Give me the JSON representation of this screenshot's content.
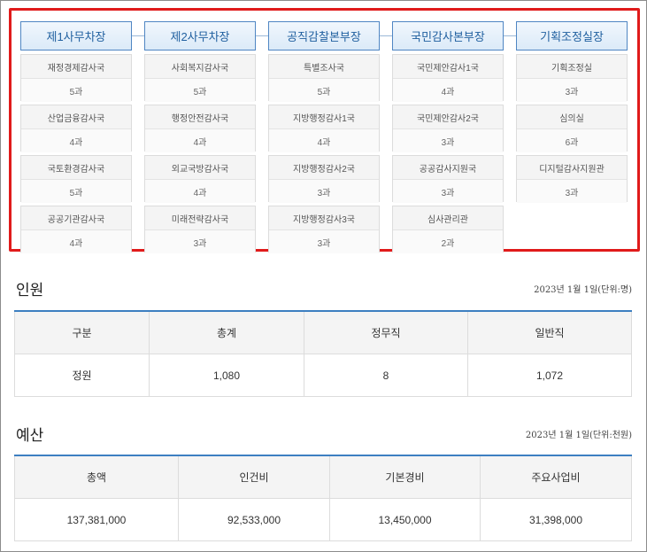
{
  "org": {
    "columns": [
      {
        "head": "제1사무차장",
        "units": [
          {
            "name": "재정경제감사국",
            "count": "5과"
          },
          {
            "name": "산업금융감사국",
            "count": "4과"
          },
          {
            "name": "국토환경감사국",
            "count": "5과"
          },
          {
            "name": "공공기관감사국",
            "count": "4과"
          }
        ]
      },
      {
        "head": "제2사무차장",
        "units": [
          {
            "name": "사회복지감사국",
            "count": "5과"
          },
          {
            "name": "행정안전감사국",
            "count": "4과"
          },
          {
            "name": "외교국방감사국",
            "count": "4과"
          },
          {
            "name": "미래전략감사국",
            "count": "3과"
          }
        ]
      },
      {
        "head": "공직감찰본부장",
        "units": [
          {
            "name": "특별조사국",
            "count": "5과"
          },
          {
            "name": "지방행정감사1국",
            "count": "4과"
          },
          {
            "name": "지방행정감사2국",
            "count": "3과"
          },
          {
            "name": "지방행정감사3국",
            "count": "3과"
          }
        ]
      },
      {
        "head": "국민감사본부장",
        "units": [
          {
            "name": "국민제안감사1국",
            "count": "4과"
          },
          {
            "name": "국민제안감사2국",
            "count": "3과"
          },
          {
            "name": "공공감사지원국",
            "count": "3과"
          },
          {
            "name": "심사관리관",
            "count": "2과"
          }
        ]
      },
      {
        "head": "기획조정실장",
        "units": [
          {
            "name": "기획조정실",
            "count": "3과"
          },
          {
            "name": "심의실",
            "count": "6과"
          },
          {
            "name": "디지털감사지원관",
            "count": "3과"
          }
        ]
      }
    ]
  },
  "personnel": {
    "title": "인원",
    "note": "2023년 1월 1일(단위:명)",
    "headers": [
      "구분",
      "총계",
      "정무직",
      "일반직"
    ],
    "row": [
      "정원",
      "1,080",
      "8",
      "1,072"
    ]
  },
  "budget": {
    "title": "예산",
    "note": "2023년 1월 1일(단위:천원)",
    "headers": [
      "총액",
      "인건비",
      "기본경비",
      "주요사업비"
    ],
    "row": [
      "137,381,000",
      "92,533,000",
      "13,450,000",
      "31,398,000"
    ]
  }
}
